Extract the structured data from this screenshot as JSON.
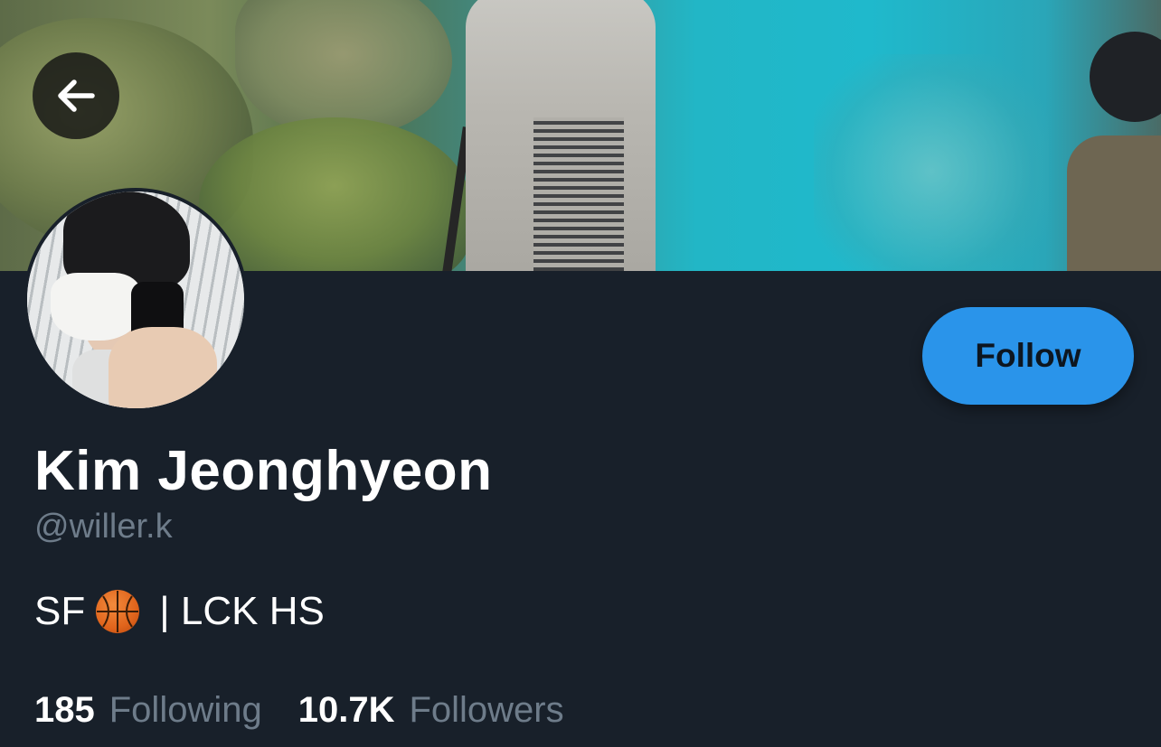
{
  "profile": {
    "name": "Kim Jeonghyeon",
    "handle": "@willer.k",
    "bio_prefix": "SF",
    "bio_emoji": "basketball-icon",
    "bio_suffix": "| LCK HS",
    "following_count": "185",
    "following_label": "Following",
    "followers_count": "10.7K",
    "followers_label": "Followers"
  },
  "actions": {
    "follow_label": "Follow",
    "back_icon": "arrow-left-icon"
  },
  "colors": {
    "background": "#18202a",
    "accent": "#2a94ea",
    "muted_text": "#6e7c8a"
  }
}
